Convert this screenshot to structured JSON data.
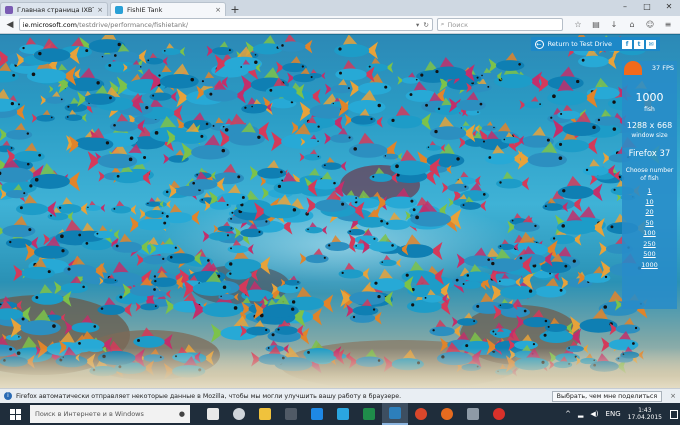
{
  "browser": {
    "tabs": [
      {
        "title": "Главная страница IXBT.co...",
        "active": false
      },
      {
        "title": "FishIE Tank",
        "active": true
      }
    ],
    "url_domain": "ie.microsoft.com",
    "url_path": "/testdrive/performance/fishietank/",
    "search_placeholder": "Поиск"
  },
  "page": {
    "return_label": "Return to Test Drive",
    "social": [
      "f",
      "t",
      "✉"
    ],
    "fps_label": "37 FPS",
    "fish_count": "1000",
    "fish_label": "fish",
    "window_size": "1288 x 668",
    "window_size_label": "window size",
    "browser_label": "Firefox 37",
    "choose_label": "Choose number of fish",
    "fish_options": [
      "1",
      "10",
      "20",
      "50",
      "100",
      "250",
      "500",
      "1000"
    ]
  },
  "notification": {
    "message": "Firefox автоматически отправляет некоторые данные в Mozilla, чтобы мы могли улучшить вашу работу в браузере.",
    "button": "Выбрать, чем мне поделиться",
    "close": "×"
  },
  "taskbar": {
    "search_placeholder": "Поиск в Интернете и в Windows",
    "lang": "ENG",
    "time": "1:43",
    "date": "17.04.2015",
    "apps": [
      {
        "name": "task-view",
        "color": "#e8e8e8"
      },
      {
        "name": "cortana",
        "color": "#cfd5db"
      },
      {
        "name": "file-explorer",
        "color": "#f0c23c"
      },
      {
        "name": "store",
        "color": "#505a66"
      },
      {
        "name": "windows",
        "color": "#1e88e5"
      },
      {
        "name": "internet-explorer",
        "color": "#2aa6e0"
      },
      {
        "name": "excel",
        "color": "#1f8c4a"
      },
      {
        "name": "fishie",
        "color": "#2d7fbb"
      },
      {
        "name": "chrome",
        "color": "#d9472b"
      },
      {
        "name": "firefox",
        "color": "#e66b1f"
      },
      {
        "name": "photos",
        "color": "#8e9aa6"
      },
      {
        "name": "opera",
        "color": "#d8312a"
      }
    ]
  },
  "colors": {
    "accent": "#1d88c8",
    "fps_gauge": "#f26a1b"
  }
}
